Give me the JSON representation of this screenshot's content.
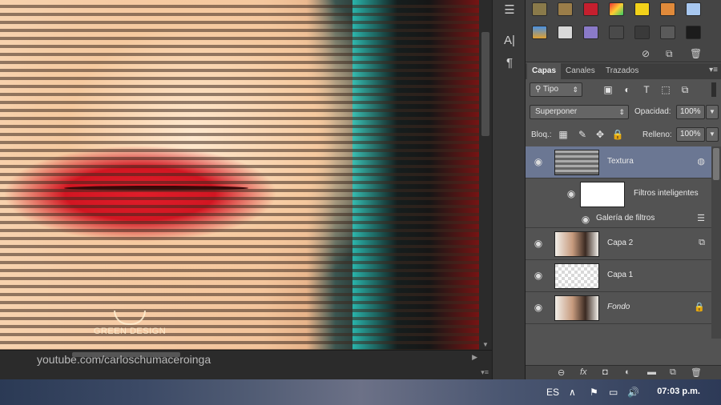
{
  "canvas": {
    "watermark_brand": "GREEN DESIGN",
    "watermark_url": "youtube.com/carloschumaceroinga"
  },
  "layers_panel": {
    "tabs": [
      "Capas",
      "Canales",
      "Trazados"
    ],
    "filter_label": "Tipo",
    "blend_mode": "Superponer",
    "opacity_label": "Opacidad:",
    "opacity_value": "100%",
    "lock_label": "Bloq.:",
    "fill_label": "Relleno:",
    "fill_value": "100%",
    "layers": [
      {
        "name": "Textura",
        "selected": true
      },
      {
        "name": "Filtros inteligentes"
      },
      {
        "name": "Galería de filtros"
      },
      {
        "name": "Capa 2"
      },
      {
        "name": "Capa 1"
      },
      {
        "name": "Fondo",
        "locked": true
      }
    ]
  },
  "taskbar": {
    "language": "ES",
    "time": "07:03 p.m."
  },
  "colors": {
    "selected_layer": "#6b7793",
    "panel_bg": "#535353"
  }
}
